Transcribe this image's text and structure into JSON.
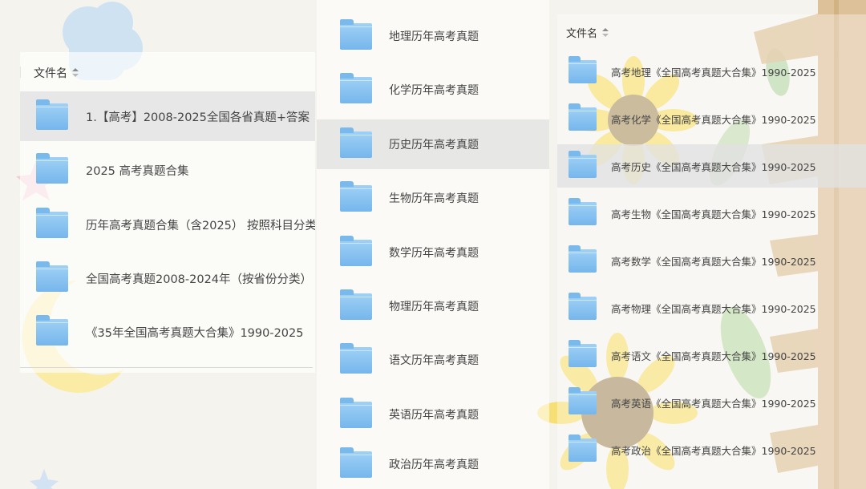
{
  "left_panel": {
    "header": "文件名",
    "items": [
      {
        "label": "1.【高考】2008-2025全国各省真题+答案"
      },
      {
        "label": "2025 高考真题合集"
      },
      {
        "label": "历年高考真题合集（含2025） 按照科目分类"
      },
      {
        "label": "全国高考真题2008-2024年（按省份分类）"
      },
      {
        "label": "《35年全国高考真题大合集》1990-2025"
      }
    ]
  },
  "middle_panel": {
    "items": [
      {
        "label": "地理历年高考真题"
      },
      {
        "label": "化学历年高考真题"
      },
      {
        "label": "历史历年高考真题"
      },
      {
        "label": "生物历年高考真题"
      },
      {
        "label": "数学历年高考真题"
      },
      {
        "label": "物理历年高考真题"
      },
      {
        "label": "语文历年高考真题"
      },
      {
        "label": "英语历年高考真题"
      },
      {
        "label": "政治历年高考真题"
      }
    ]
  },
  "right_panel": {
    "header": "文件名",
    "items": [
      {
        "label": "高考地理《全国高考真题大合集》1990-2025"
      },
      {
        "label": "高考化学《全国高考真题大合集》1990-2025"
      },
      {
        "label": "高考历史《全国高考真题大合集》1990-2025"
      },
      {
        "label": "高考生物《全国高考真题大合集》1990-2025"
      },
      {
        "label": "高考数学《全国高考真题大合集》1990-2025"
      },
      {
        "label": "高考物理《全国高考真题大合集》1990-2025"
      },
      {
        "label": "高考语文《全国高考真题大合集》1990-2025"
      },
      {
        "label": "高考英语《全国高考真题大合集》1990-2025"
      },
      {
        "label": "高考政治《全国高考真题大合集》1990-2025"
      }
    ]
  },
  "icons": {
    "folder": "folder-icon",
    "sort": "sort-icon"
  },
  "colors": {
    "folder": "#8cc6f2",
    "row_highlight": "#e1e1e1",
    "text": "#444444"
  }
}
